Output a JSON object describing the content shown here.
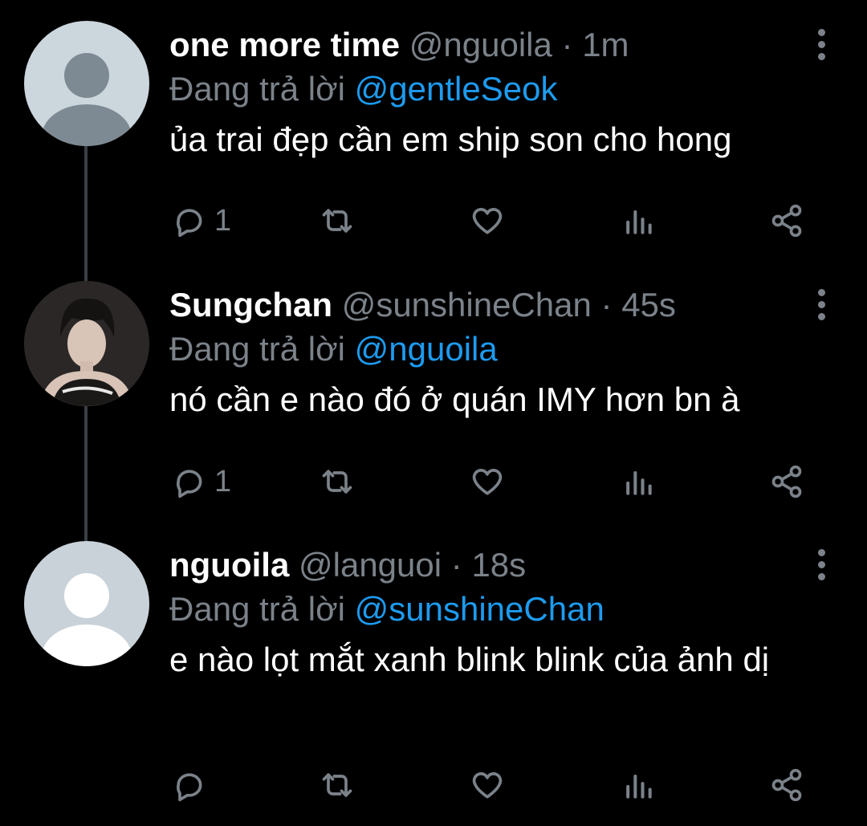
{
  "tweets": [
    {
      "name": "one more time",
      "handle": "@nguoila",
      "separator": "·",
      "time": "1m",
      "reply_prefix": "Đang trả lời",
      "reply_to": "@gentleSeok",
      "text": "ủa trai đẹp cần em ship son cho hong",
      "reply_count": "1",
      "avatar_type": "default-dark"
    },
    {
      "name": "Sungchan",
      "handle": "@sunshineChan",
      "separator": "·",
      "time": "45s",
      "reply_prefix": "Đang trả lời",
      "reply_to": "@nguoila",
      "text": "nó cần e nào đó ở quán IMY hơn bn à",
      "reply_count": "1",
      "avatar_type": "photo"
    },
    {
      "name": "nguoila",
      "handle": "@languoi",
      "separator": "·",
      "time": "18s",
      "reply_prefix": "Đang trả lời",
      "reply_to": "@sunshineChan",
      "text": "e nào lọt mắt xanh blink blink của ảnh dị",
      "reply_count": "",
      "avatar_type": "default-light"
    }
  ],
  "colors": {
    "background": "#000000",
    "name": "#ffffff",
    "muted": "#7b8289",
    "mention": "#1d9bf0",
    "connector": "#3a3f44"
  },
  "icons": [
    "reply-icon",
    "retweet-icon",
    "like-icon",
    "analytics-icon",
    "share-icon",
    "more-icon"
  ]
}
